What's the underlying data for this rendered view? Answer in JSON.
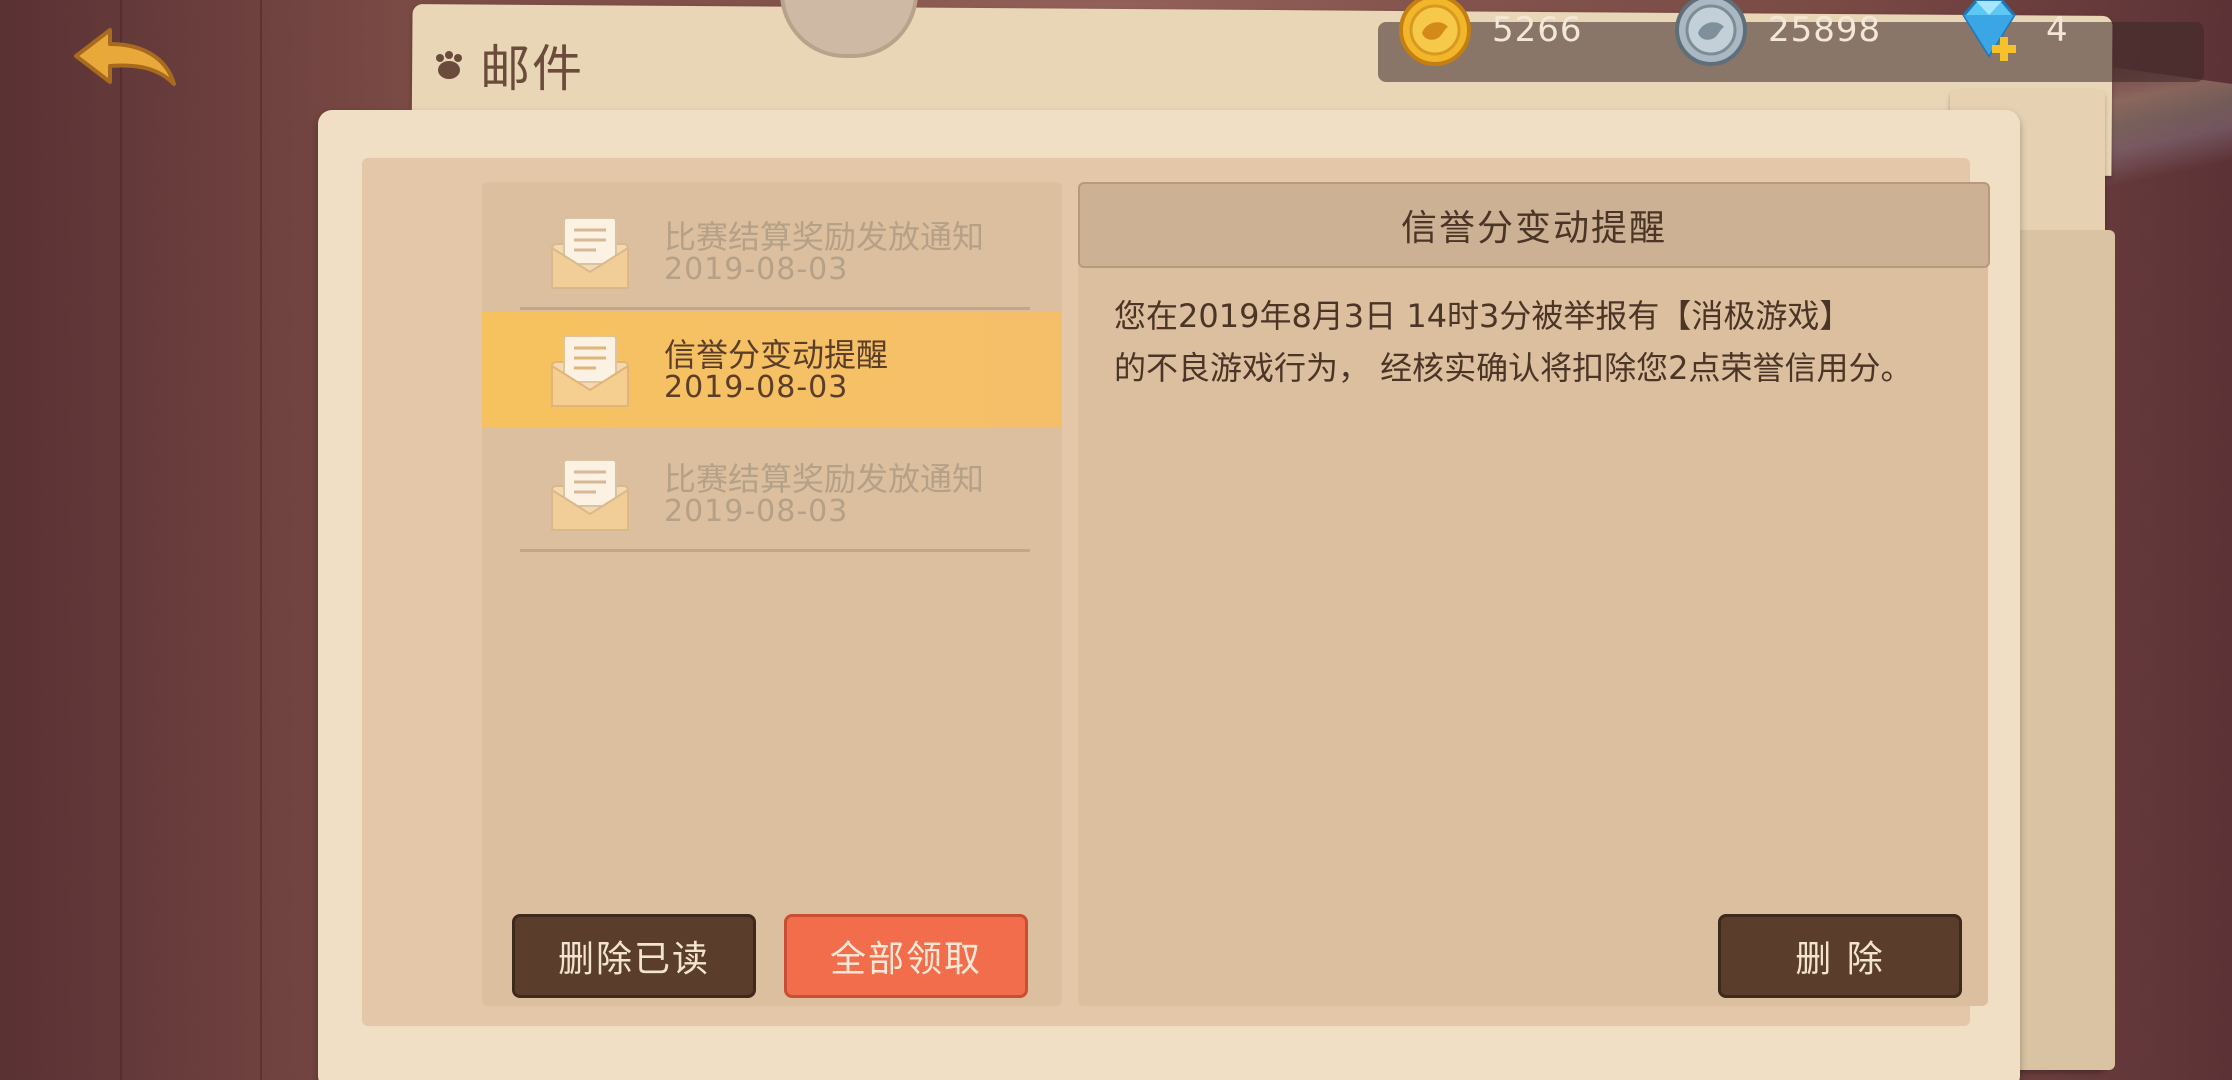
{
  "header": {
    "title": "邮件",
    "back_icon": "back-arrow-icon",
    "title_icon": "paw-icon"
  },
  "currencies": [
    {
      "name": "gold-coin",
      "value": "5266",
      "color": "#f2b62a"
    },
    {
      "name": "silver-coin",
      "value": "25898",
      "color": "#a9b8c2"
    },
    {
      "name": "diamond",
      "value": "4",
      "color": "#5ec8f5"
    }
  ],
  "mail_list": {
    "items": [
      {
        "subject": "比赛结算奖励发放通知",
        "date": "2019-08-03",
        "selected": false
      },
      {
        "subject": "信誉分变动提醒",
        "date": "2019-08-03",
        "selected": true
      },
      {
        "subject": "比赛结算奖励发放通知",
        "date": "2019-08-03",
        "selected": false
      }
    ],
    "delete_read_label": "删除已读",
    "claim_all_label": "全部领取"
  },
  "detail": {
    "title": "信誉分变动提醒",
    "body_line1": "您在2019年8月3日 14时3分被举报有【消极游戏】",
    "body_line2": "的不良游戏行为， 经核实确认将扣除您2点荣誉信用分。",
    "delete_label": "删 除"
  },
  "colors": {
    "selected_row": "#f6c25f",
    "dark_button": "#5a3e2b",
    "orange_button": "#f26d4c"
  }
}
